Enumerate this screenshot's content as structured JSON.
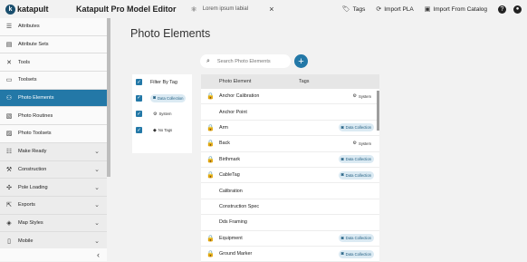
{
  "app": {
    "logo_text": "katapult",
    "title": "Katapult Pro Model Editor",
    "doc_tab": "Lorem ipsum labial",
    "doc_tab_icon": "atom-icon",
    "close_glyph": "×"
  },
  "toolbar": {
    "tags": "Tags",
    "import_pla": "Import PLA",
    "import_catalog": "Import From Catalog",
    "help_glyph": "?",
    "user_glyph": "●"
  },
  "sidebar": {
    "items": [
      {
        "label": "Attributes",
        "icon": "list-icon"
      },
      {
        "label": "Attribute Sets",
        "icon": "folder-icon"
      },
      {
        "label": "Tools",
        "icon": "tools-icon"
      },
      {
        "label": "Toolsets",
        "icon": "folder-icon"
      },
      {
        "label": "Photo Elements",
        "icon": "people-icon",
        "active": true
      },
      {
        "label": "Photo Routines",
        "icon": "routine-icon"
      },
      {
        "label": "Photo Toolsets",
        "icon": "photo-folder-icon"
      },
      {
        "label": "Make Ready",
        "icon": "checklist-icon",
        "group": true
      },
      {
        "label": "Construction",
        "icon": "hammer-icon",
        "group": true
      },
      {
        "label": "Pole Loading",
        "icon": "pole-icon",
        "group": true
      },
      {
        "label": "Exports",
        "icon": "export-icon",
        "group": true
      },
      {
        "label": "Map Styles",
        "icon": "map-icon",
        "group": true
      },
      {
        "label": "Mobile",
        "icon": "mobile-icon",
        "group": true
      }
    ],
    "collapse_glyph": "‹"
  },
  "main": {
    "title": "Photo Elements",
    "search_placeholder": "Search Photo Elements",
    "add_glyph": "+"
  },
  "filter": {
    "header": "Filter By Tag",
    "options": [
      {
        "label": "Data Collection",
        "style": "blue",
        "icon": "camera-icon"
      },
      {
        "label": "System",
        "style": "plain",
        "icon": "gear-icon"
      },
      {
        "label": "No Tags",
        "style": "plain",
        "icon": "tag-icon"
      }
    ]
  },
  "table": {
    "col_element": "Photo Element",
    "col_tags": "Tags",
    "rows": [
      {
        "name": "Anchor Calibration",
        "locked": true,
        "tag": "System",
        "tag_style": "plain"
      },
      {
        "name": "Anchor Point",
        "locked": false,
        "tag": "",
        "tag_style": ""
      },
      {
        "name": "Arm",
        "locked": true,
        "tag": "Data Collection",
        "tag_style": "blue"
      },
      {
        "name": "Back",
        "locked": true,
        "tag": "System",
        "tag_style": "plain"
      },
      {
        "name": "Birthmark",
        "locked": true,
        "tag": "Data Collection",
        "tag_style": "blue"
      },
      {
        "name": "CableTag",
        "locked": true,
        "tag": "Data Collection",
        "tag_style": "blue"
      },
      {
        "name": "Calibration",
        "locked": false,
        "tag": "",
        "tag_style": ""
      },
      {
        "name": "Construction Spec",
        "locked": false,
        "tag": "",
        "tag_style": ""
      },
      {
        "name": "Dds Framing",
        "locked": false,
        "tag": "",
        "tag_style": ""
      },
      {
        "name": "Equipment",
        "locked": true,
        "tag": "Data Collection",
        "tag_style": "blue"
      },
      {
        "name": "Ground Marker",
        "locked": true,
        "tag": "Data Collection",
        "tag_style": "blue"
      }
    ]
  },
  "colors": {
    "accent": "#2378a7",
    "lock": "#d32f2f",
    "chip_blue_bg": "#dbeaf3"
  }
}
